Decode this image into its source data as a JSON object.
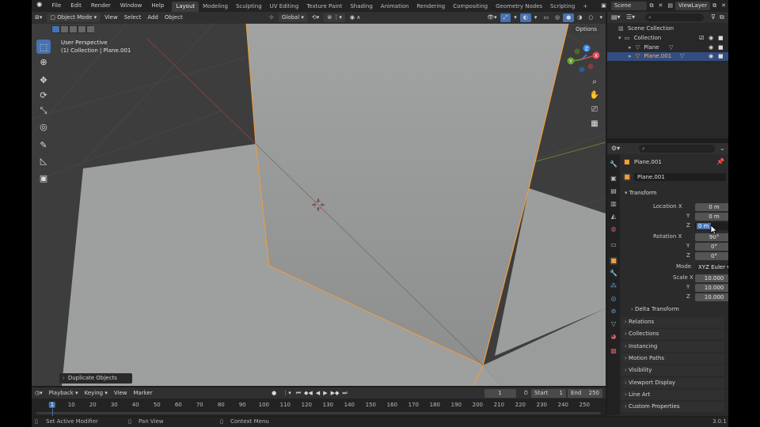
{
  "topbar": {
    "menus": [
      "File",
      "Edit",
      "Render",
      "Window",
      "Help"
    ],
    "workspaces": [
      "Layout",
      "Modeling",
      "Sculpting",
      "UV Editing",
      "Texture Paint",
      "Shading",
      "Animation",
      "Rendering",
      "Compositing",
      "Geometry Nodes",
      "Scripting"
    ],
    "active_workspace": "Layout",
    "add_tab": "+",
    "scene": "Scene",
    "view_layer": "ViewLayer"
  },
  "viewport_header": {
    "mode": "Object Mode",
    "menus": [
      "View",
      "Select",
      "Add",
      "Object"
    ],
    "orientation": "Global",
    "options": "Options"
  },
  "viewport": {
    "view_name": "User Perspective",
    "collection_info": "(1) Collection | Plane.001",
    "last_operation": "Duplicate Objects",
    "gizmo_axes": [
      "X",
      "Y",
      "Z"
    ]
  },
  "outliner": {
    "root": "Scene Collection",
    "collection": "Collection",
    "items": [
      "Plane",
      "Plane.001"
    ]
  },
  "properties": {
    "object_name": "Plane.001",
    "data_name": "Plane.001",
    "transform_label": "Transform",
    "location_label": "Location X",
    "rotation_label": "Rotation X",
    "scale_label": "Scale X",
    "axis_y": "Y",
    "axis_z": "Z",
    "location": [
      "0 m",
      "0 m",
      "0 m"
    ],
    "rotation": [
      "90°",
      "0°",
      "0°"
    ],
    "mode_label": "Mode",
    "mode_value": "XYZ Euler",
    "scale": [
      "10.000",
      "10.000",
      "10.000"
    ],
    "delta_transform": "Delta Transform",
    "panels": [
      "Relations",
      "Collections",
      "Instancing",
      "Motion Paths",
      "Visibility",
      "Viewport Display",
      "Line Art",
      "Custom Properties"
    ]
  },
  "timeline": {
    "menus": [
      "Playback",
      "Keying",
      "View",
      "Marker"
    ],
    "current_frame": "1",
    "start_label": "Start",
    "start": "1",
    "end_label": "End",
    "end": "250",
    "ticks": [
      "1",
      "10",
      "20",
      "30",
      "40",
      "50",
      "60",
      "70",
      "80",
      "90",
      "100",
      "110",
      "120",
      "130",
      "140",
      "150",
      "160",
      "170",
      "180",
      "190",
      "200",
      "210",
      "220",
      "230",
      "240",
      "250"
    ]
  },
  "statusbar": {
    "items": [
      "Set Active Modifier",
      "Pan View",
      "Context Menu"
    ],
    "version": "3.0.1"
  },
  "colors": {
    "accent": "#4772b3",
    "selection_outline": "#f29d3a",
    "active_row": "#334d80"
  }
}
